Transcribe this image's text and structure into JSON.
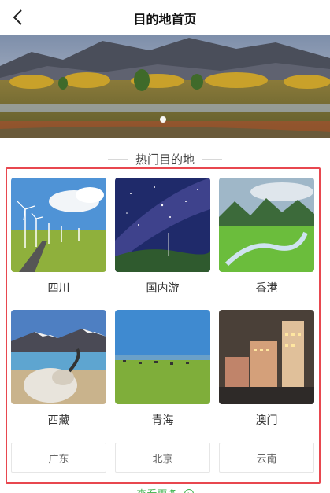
{
  "header": {
    "title": "目的地首页",
    "back_icon": "chevron-left-icon"
  },
  "banner": {
    "image": "mountain-lake-landscape",
    "carousel_index": 1,
    "carousel_count": 1
  },
  "section": {
    "title": "热门目的地"
  },
  "destinations": [
    {
      "name": "四川",
      "image": "wind-turbines-meadow"
    },
    {
      "name": "国内游",
      "image": "milky-way-night"
    },
    {
      "name": "香港",
      "image": "green-valley-river"
    },
    {
      "name": "西藏",
      "image": "yak-skull-lake"
    },
    {
      "name": "青海",
      "image": "grassland-horses"
    },
    {
      "name": "澳门",
      "image": "casino-city-night"
    }
  ],
  "chips": [
    "广东",
    "北京",
    "云南"
  ],
  "more": {
    "label": "查看更多",
    "icon": "arrow-circle-icon"
  },
  "colors": {
    "highlight_frame": "#e8474f",
    "accent_green": "#3db24b"
  }
}
